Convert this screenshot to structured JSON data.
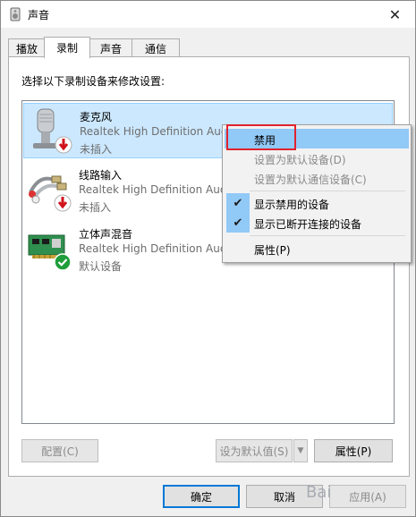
{
  "window": {
    "title": "声音",
    "close_glyph": "✕"
  },
  "tabs": [
    {
      "label": "播放",
      "active": false
    },
    {
      "label": "录制",
      "active": true
    },
    {
      "label": "声音",
      "active": false
    },
    {
      "label": "通信",
      "active": false
    }
  ],
  "instruction": "选择以下录制设备来修改设置:",
  "devices": [
    {
      "name": "麦克风",
      "description": "Realtek High Definition Aud",
      "status": "未插入",
      "icon": "microphone-icon",
      "badge": "red-down-arrow",
      "selected": true
    },
    {
      "name": "线路输入",
      "description": "Realtek High Definition Aud",
      "status": "未插入",
      "icon": "line-in-cable-icon",
      "badge": "red-down-arrow",
      "selected": false
    },
    {
      "name": "立体声混音",
      "description": "Realtek High Definition Aud",
      "status": "默认设备",
      "icon": "sound-card-icon",
      "badge": "green-check",
      "selected": false
    }
  ],
  "context_menu": {
    "items": [
      {
        "label": "禁用",
        "highlighted": true,
        "disabled": false,
        "checked": false
      },
      {
        "label": "设置为默认设备(D)",
        "disabled": true,
        "checked": false
      },
      {
        "label": "设置为默认通信设备(C)",
        "disabled": true,
        "checked": false
      },
      {
        "label": "显示禁用的设备",
        "disabled": false,
        "checked": true
      },
      {
        "label": "显示已断开连接的设备",
        "disabled": false,
        "checked": true
      },
      {
        "label": "属性(P)",
        "disabled": false,
        "checked": false
      }
    ]
  },
  "buttons": {
    "configure": "配置(C)",
    "set_default": "设为默认值(S)",
    "properties": "属性(P)",
    "ok": "确定",
    "cancel": "取消",
    "apply": "应用(A)"
  },
  "watermark": "Bai",
  "colors": {
    "accent": "#0078d7",
    "selection": "#cce8ff",
    "menu_highlight": "#91c9f7",
    "annotation_red": "#e0232e"
  }
}
